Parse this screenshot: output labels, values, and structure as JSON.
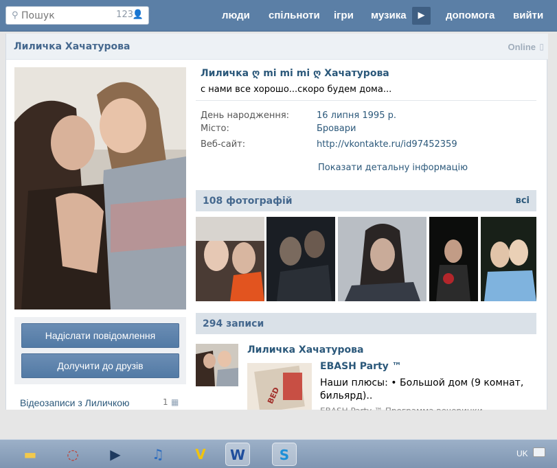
{
  "header": {
    "search_placeholder": "Пошук",
    "search_count": "123",
    "nav": [
      "люди",
      "спільноти",
      "ігри",
      "музика",
      "допомога",
      "вийти"
    ]
  },
  "profile": {
    "name": "Лиличка Хачатурова",
    "online": "Online",
    "full_name": "Лиличка ღ mi mi mi ღ Хачатурова",
    "status": "с нами все хорошо...скоро будем дома...",
    "info": [
      {
        "label": "День народження:",
        "value": "16 липня 1995 р."
      },
      {
        "label": "Місто:",
        "value": "Бровари"
      },
      {
        "label": "Веб-сайт:",
        "value": "http://vkontakte.ru/id97452359"
      }
    ],
    "show_details": "Показати детальну інформацію",
    "buttons": {
      "message": "Надіслати повідомлення",
      "add_friend": "Долучити до друзів"
    },
    "videos_label": "Відеозаписи з Лиличкою",
    "videos_count": "1"
  },
  "photos": {
    "title": "108 фотографій",
    "all": "всі"
  },
  "wall": {
    "title": "294 записи",
    "post": {
      "author": "Лиличка Хачатурова",
      "repost_title": "EBASH Party ™",
      "text": "Наши плюсы: • Большой дом (9 комнат, бильярд)..",
      "cut_line": "EBASH Party ™ Программа вечеринки"
    }
  },
  "taskbar": {
    "lang": "UK"
  },
  "colors": {
    "header_bg": "#5b7fa6",
    "link": "#2b587a",
    "section_bg": "#dae1e8"
  }
}
